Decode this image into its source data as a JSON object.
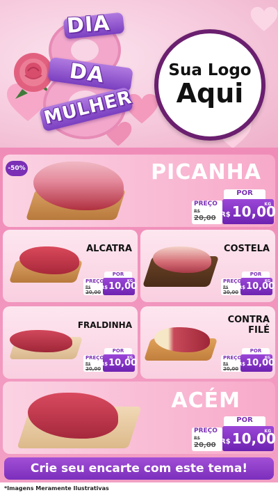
{
  "header": {
    "title_words": [
      "DIA",
      "DA",
      "MULHER"
    ],
    "logo_line1": "Sua Logo",
    "logo_line2": "Aqui",
    "colors": {
      "purple": "#7a2fb5",
      "pink": "#f08cb8"
    }
  },
  "products": [
    {
      "id": "picanha",
      "name": "PICANHA",
      "badge": "-50%",
      "por": "POR",
      "preco": "PREÇO",
      "old_price": "R$ 20,00",
      "old_cur": "R$",
      "old_value": "20,00",
      "cur": "R$",
      "price": "10,00",
      "unit": "KG"
    },
    {
      "id": "alcatra",
      "name": "ALCATRA",
      "por": "POR",
      "preco": "PREÇO",
      "old_cur": "R$",
      "old_value": "20,00",
      "cur": "R$",
      "price": "10,00",
      "unit": "KG"
    },
    {
      "id": "costela",
      "name": "COSTELA",
      "por": "POR",
      "preco": "PREÇO",
      "old_cur": "R$",
      "old_value": "20,00",
      "cur": "R$",
      "price": "10,00",
      "unit": "KG"
    },
    {
      "id": "fraldinha",
      "name": "FRALDINHA",
      "por": "POR",
      "preco": "PREÇO",
      "old_cur": "R$",
      "old_value": "20,00",
      "cur": "R$",
      "price": "10,00",
      "unit": "KG"
    },
    {
      "id": "contrafile",
      "name_line1": "CONTRA",
      "name_line2": "FILÉ",
      "por": "POR",
      "preco": "PREÇO",
      "old_cur": "R$",
      "old_value": "20,00",
      "cur": "R$",
      "price": "10,00",
      "unit": "KG"
    },
    {
      "id": "acem",
      "name": "ACÉM",
      "por": "POR",
      "preco": "PREÇO",
      "old_cur": "R$",
      "old_value": "20,00",
      "cur": "R$",
      "price": "10,00",
      "unit": "KG"
    }
  ],
  "cta": {
    "label": "Crie seu encarte com este tema!"
  },
  "footer": {
    "disclaimer": "*Imagens Meramente Ilustrativas"
  },
  "icons": [
    "heart-icon",
    "rose-icon",
    "meat-icon",
    "cutting-board-icon"
  ]
}
